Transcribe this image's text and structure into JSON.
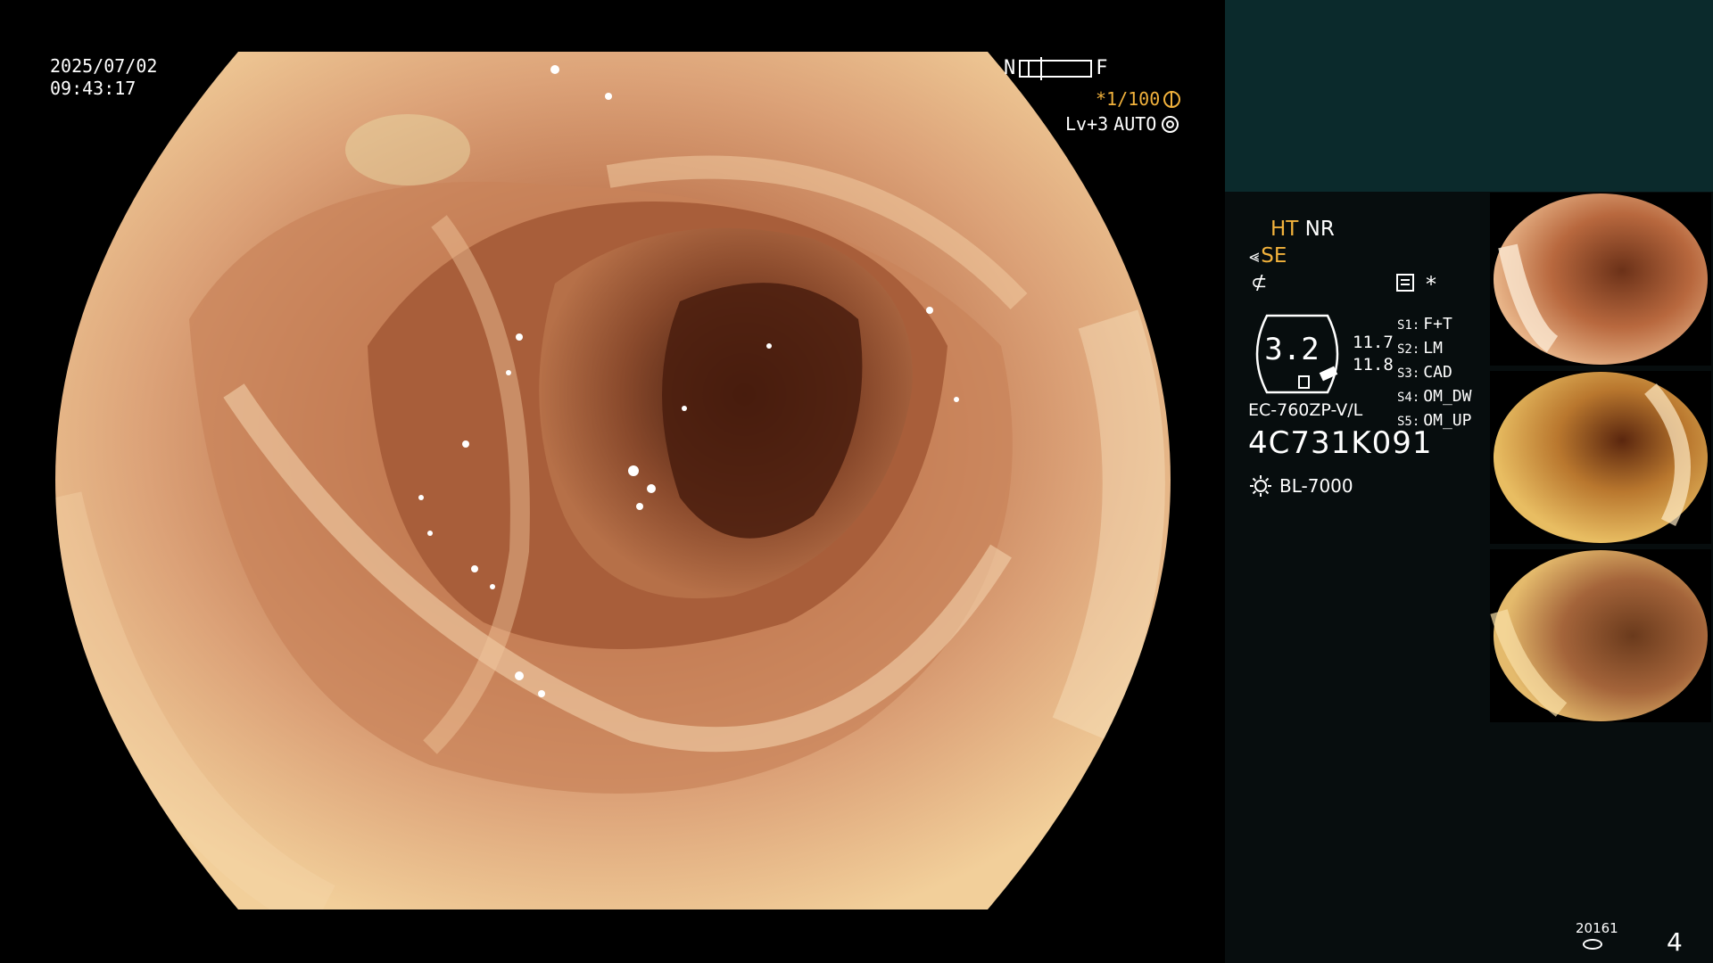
{
  "osd": {
    "date": "2025/07/02",
    "time": "09:43:17",
    "near_label": "N",
    "far_label": "F",
    "shutter": "*1/100",
    "level": "Lv+3",
    "exposure_mode": "AUTO"
  },
  "panel": {
    "ht_label": "HT",
    "nr_label": "NR",
    "se_label": "SE",
    "slash_icon": "f-slash-icon",
    "asterisk": "*",
    "zoom": "3.2",
    "value_1": "11.7",
    "value_2": "11.8",
    "scope_model": "EC-760ZP-V/L",
    "serial": "4C731K091",
    "light_source": "BL-7000",
    "switches": [
      {
        "key": "S1:",
        "value": "F+T"
      },
      {
        "key": "S2:",
        "value": "LM"
      },
      {
        "key": "S3:",
        "value": "CAD"
      },
      {
        "key": "S4:",
        "value": "OM_DW"
      },
      {
        "key": "S5:",
        "value": "OM_UP"
      }
    ],
    "counter_code": "20161",
    "image_count": "4"
  },
  "icons": {
    "gear": "gear-icon",
    "aperture": "aperture-icon",
    "menu": "menu-icon",
    "sun": "sun-icon",
    "database": "database-icon"
  },
  "colors": {
    "accent": "#f2b23c",
    "panel_top": "#0b2a2c",
    "panel": "#070d0e",
    "tissue": "#d9946a"
  }
}
